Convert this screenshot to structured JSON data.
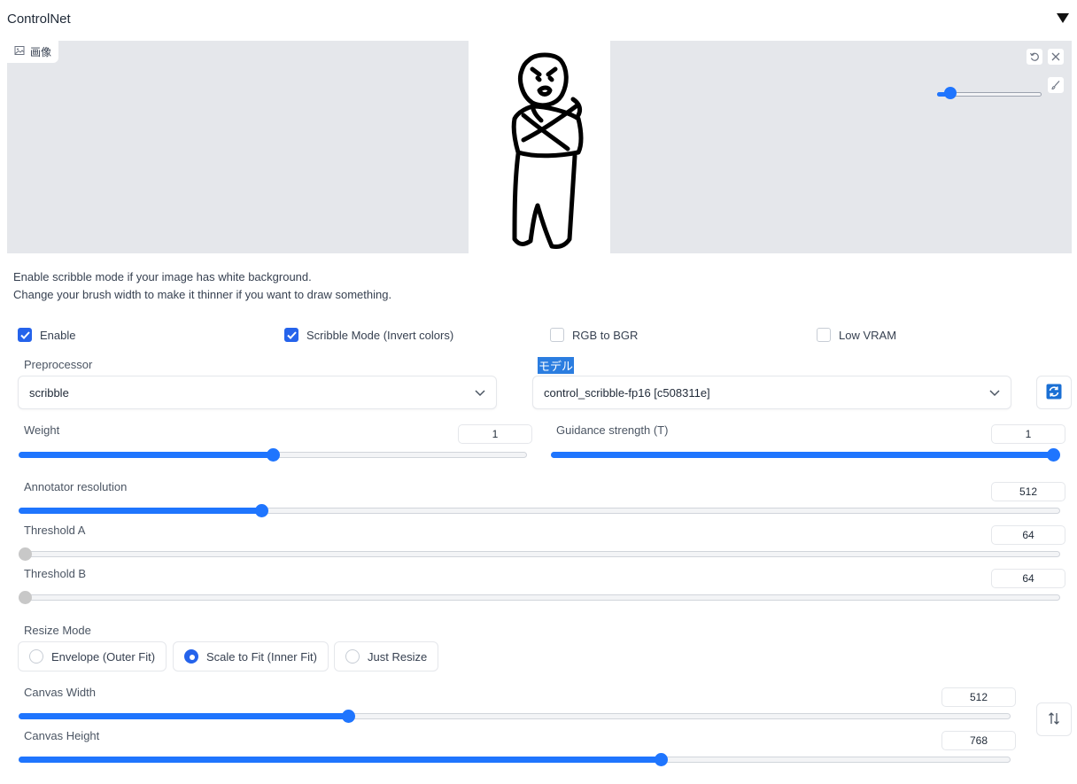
{
  "header": {
    "title": "ControlNet"
  },
  "image_panel": {
    "tab_label": "画像"
  },
  "brush_width_fraction": 0.08,
  "info": {
    "line1": "Enable scribble mode if your image has white background.",
    "line2": "Change your brush width to make it thinner if you want to draw something."
  },
  "checkboxes": [
    {
      "label": "Enable",
      "checked": true
    },
    {
      "label": "Scribble Mode (Invert colors)",
      "checked": true
    },
    {
      "label": "RGB to BGR",
      "checked": false
    },
    {
      "label": "Low VRAM",
      "checked": false
    }
  ],
  "preprocessor": {
    "label": "Preprocessor",
    "value": "scribble"
  },
  "model": {
    "label": "モデル",
    "value": "control_scribble-fp16 [c508311e]"
  },
  "weight": {
    "label": "Weight",
    "value": "1",
    "fraction": 0.5
  },
  "guidance": {
    "label": "Guidance strength (T)",
    "value": "1",
    "fraction": 1.0
  },
  "annotator_resolution": {
    "label": "Annotator resolution",
    "value": "512",
    "fraction": 0.23
  },
  "threshold_a": {
    "label": "Threshold A",
    "value": "64",
    "fraction": 0.0
  },
  "threshold_b": {
    "label": "Threshold B",
    "value": "64",
    "fraction": 0.0
  },
  "resize_mode": {
    "label": "Resize Mode",
    "options": [
      "Envelope (Outer Fit)",
      "Scale to Fit (Inner Fit)",
      "Just Resize"
    ],
    "selected": "Scale to Fit (Inner Fit)"
  },
  "canvas_width": {
    "label": "Canvas Width",
    "value": "512",
    "fraction": 0.33
  },
  "canvas_height": {
    "label": "Canvas Height",
    "value": "768",
    "fraction": 0.65
  },
  "colors": {
    "accent": "#1f75fe",
    "checkbox": "#2563eb",
    "image_bg": "#e5e7eb"
  }
}
